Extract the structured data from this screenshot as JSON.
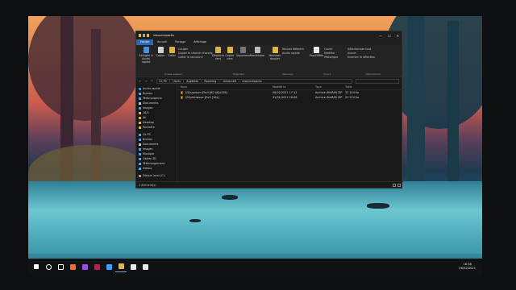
{
  "window": {
    "title": "resourcepacks",
    "controls": {
      "minimize": "—",
      "maximize": "☐",
      "close": "✕"
    }
  },
  "ribbon_tabs": [
    {
      "label": "Fichier",
      "active": true
    },
    {
      "label": "Accueil",
      "active": false
    },
    {
      "label": "Partage",
      "active": false
    },
    {
      "label": "Affichage",
      "active": false
    }
  ],
  "ribbon": {
    "pin_label": "Épingler à Accès rapide",
    "copy_label": "Copier",
    "paste_label": "Coller",
    "cut_label": "Couper",
    "copy_path_label": "Copier le chemin d'accès",
    "paste_shortcut_label": "Coller le raccourci",
    "clipboard_group": "Presse-papiers",
    "move_label": "Déplacer vers",
    "copyto_label": "Copier vers",
    "delete_label": "Supprimer",
    "rename_label": "Renommer",
    "organize_group": "Organiser",
    "new_folder_label": "Nouveau dossier",
    "new_item_label": "Nouvel élément",
    "easy_access_label": "Accès rapide",
    "new_group": "Nouveau",
    "properties_label": "Propriétés",
    "open_label": "Ouvrir",
    "edit_label": "Modifier",
    "history_label": "Historique",
    "open_group": "Ouvrir",
    "select_all_label": "Sélectionner tout",
    "select_none_label": "Aucun",
    "invert_label": "Inverser la sélection",
    "select_group": "Sélectionner"
  },
  "address": {
    "segments": [
      "Ce PC",
      "Users",
      "AppData",
      "Roaming",
      ".minecraft",
      "resourcepacks"
    ]
  },
  "nav": {
    "items": [
      {
        "label": "Accès rapide",
        "color": "#3d8ee0"
      },
      {
        "label": "Bureau",
        "color": "#4aa3e8"
      },
      {
        "label": "Téléchargeme",
        "color": "#4aa3e8"
      },
      {
        "label": "Documents",
        "color": "#c9c9c9"
      },
      {
        "label": "Images",
        "color": "#5aa0d8"
      },
      {
        "label": "16/2",
        "color": "#e0b64a"
      },
      {
        "label": "All",
        "color": "#e0b64a"
      },
      {
        "label": "Desktop",
        "color": "#e0b64a"
      },
      {
        "label": "Pochette",
        "color": "#e0b64a"
      },
      {
        "label": "Ce PC",
        "color": "#4aa3e8"
      },
      {
        "label": "Bureau",
        "color": "#4aa3e8"
      },
      {
        "label": "Documents",
        "color": "#c9c9c9"
      },
      {
        "label": "Images",
        "color": "#5aa0d8"
      },
      {
        "label": "Musique",
        "color": "#4aa3e8"
      },
      {
        "label": "Objets 3D",
        "color": "#4aa3e8"
      },
      {
        "label": "Téléchargement",
        "color": "#4aa3e8"
      },
      {
        "label": "Vidéos",
        "color": "#4aa3e8"
      },
      {
        "label": "Disque local (C:)",
        "color": "#9a9a9a"
      }
    ]
  },
  "columns": {
    "name": "Nom",
    "date": "Modifié le",
    "type": "Type",
    "size": "Taille"
  },
  "files": [
    {
      "name": "§3Quantum §9v3.§62 §6[x256]",
      "date": "06/02/2021 17:12",
      "type": "Archive WinRAR ZIP",
      "size": "32 144 Ko"
    },
    {
      "name": "§5Synthwave §9v2 [16x]",
      "date": "31/01/2021 18:08",
      "type": "Archive WinRAR ZIP",
      "size": "21 574 Ko"
    }
  ],
  "status": {
    "count": "2 élément(s)"
  },
  "taskbar": {
    "items": [
      {
        "name": "start",
        "color": "#ffffff"
      },
      {
        "name": "search",
        "color": "#ffffff"
      },
      {
        "name": "task-view",
        "color": "#ffffff"
      },
      {
        "name": "brave",
        "color": "#f36b2a"
      },
      {
        "name": "premiere",
        "color": "#9a4de0"
      },
      {
        "name": "app",
        "color": "#c21d4a"
      },
      {
        "name": "photoshop",
        "color": "#3da0ff"
      },
      {
        "name": "file-explorer",
        "color": "#e0b64a"
      },
      {
        "name": "obs",
        "color": "#e8e8e8"
      },
      {
        "name": "notepad",
        "color": "#e8e8e8"
      }
    ],
    "time": "18:38",
    "date": "06/02/2021"
  }
}
